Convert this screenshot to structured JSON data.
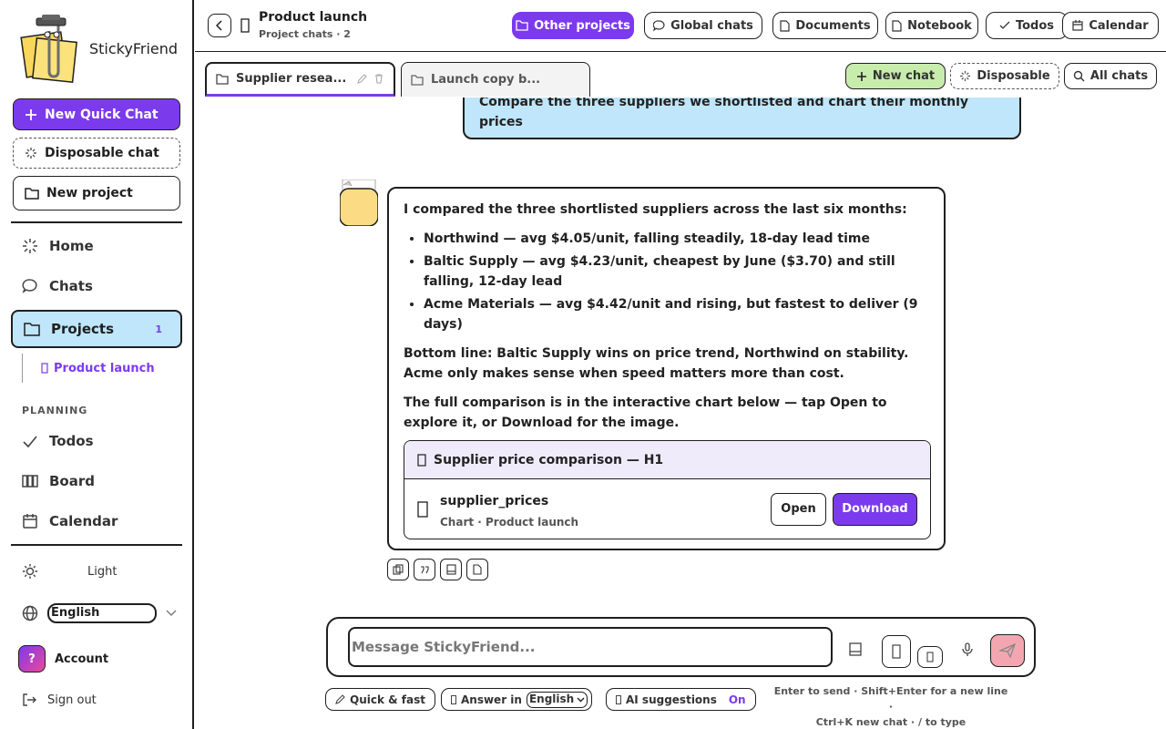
{
  "sidebar": {
    "brand": "StickyFriend",
    "new_quick_chat": "New Quick Chat",
    "disposable_chat": "Disposable chat",
    "new_project": "New project",
    "nav": {
      "home": "Home",
      "chats": "Chats",
      "projects": "Projects",
      "projects_count": "1"
    },
    "sub_project": "Product launch",
    "planning_heading": "PLANNING",
    "planning": {
      "todos": "Todos",
      "board": "Board",
      "calendar": "Calendar"
    },
    "theme": "Light",
    "language": "English",
    "account_initial": "?",
    "account": "Account",
    "sign_out": "Sign out"
  },
  "header": {
    "title": "Product launch",
    "subtitle": "Project chats · 2",
    "other_projects": "Other projects",
    "global_chats": "Global chats",
    "documents": "Documents",
    "notebook": "Notebook",
    "todos": "Todos",
    "calendar": "Calendar"
  },
  "tabs": [
    {
      "label": "Supplier resea...",
      "active": true
    },
    {
      "label": "Launch copy b...",
      "active": false
    }
  ],
  "tab_actions": {
    "new_chat": "New chat",
    "disposable": "Disposable",
    "all_chats": "All chats"
  },
  "messages": {
    "user": "Compare the three suppliers we shortlisted and chart their monthly prices",
    "assistant": {
      "intro": "I compared the three shortlisted suppliers across the last six months:",
      "bullets": [
        "Northwind — avg $4.05/unit, falling steadily, 18-day lead time",
        "Baltic Supply — avg $4.23/unit, cheapest by June ($3.70) and still falling, 12-day lead",
        "Acme Materials — avg $4.42/unit and rising, but fastest to deliver (9 days)"
      ],
      "bottom_line": "Bottom line: Baltic Supply wins on price trend, Northwind on stability. Acme only makes sense when speed matters more than cost.",
      "outro": "The full comparison is in the interactive chart below — tap Open to explore it, or Download for the image.",
      "artifact": {
        "title": "Supplier price comparison — H1",
        "file_name": "supplier_prices",
        "file_meta": "Chart · Product launch",
        "open": "Open",
        "download": "Download"
      }
    }
  },
  "composer": {
    "placeholder": "Message StickyFriend...",
    "quick_fast": "Quick & fast",
    "answer_in": "Answer in",
    "answer_lang": "English",
    "ai_suggestions": "AI suggestions",
    "ai_state": "On",
    "hint1": "Enter to send · Shift+Enter for a new line ·",
    "hint2": "Ctrl+K new chat · / to type"
  },
  "colors": {
    "accent": "#7c3aed",
    "user_bubble": "#bfe6fb",
    "new_chat": "#c7ecac",
    "send": "#f4a6b0"
  }
}
